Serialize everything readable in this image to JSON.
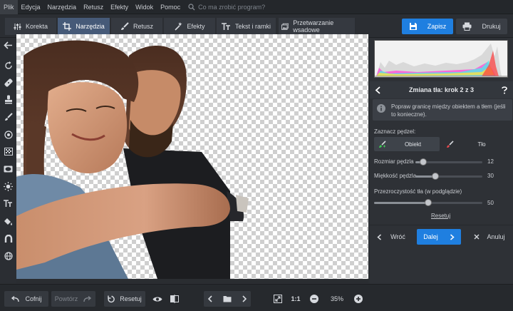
{
  "menu": [
    "Plik",
    "Edycja",
    "Narzędzia",
    "Retusz",
    "Efekty",
    "Widok",
    "Pomoc"
  ],
  "search": {
    "placeholder": "Co ma zrobić program?"
  },
  "tabs": [
    {
      "label": "Korekta",
      "icon": "sliders-icon"
    },
    {
      "label": "Narzędzia",
      "icon": "crop-icon",
      "active": true
    },
    {
      "label": "Retusz",
      "icon": "brush-icon"
    },
    {
      "label": "Efekty",
      "icon": "magic-wand-icon"
    },
    {
      "label": "Tekst i ramki",
      "icon": "text-icon"
    },
    {
      "label": "Przetwarzanie wsadowe",
      "icon": "images-icon"
    }
  ],
  "actions": {
    "save": "Zapisz",
    "print": "Drukuj"
  },
  "panel": {
    "title": "Zmiana tła: krok 2 z 3",
    "info": "Popraw granicę między obiektem a tłem (jeśli to konieczne).",
    "brush_label": "Zaznacz pędzel:",
    "object_label": "Obiekt",
    "background_label": "Tło",
    "sliders": [
      {
        "label": "Rozmiar pędzla",
        "value": "12",
        "fraction": 0.12
      },
      {
        "label": "Miękkość pędzla",
        "value": "30",
        "fraction": 0.3
      },
      {
        "label": "Przezroczystość tła (w podglądzie)",
        "value": "50",
        "fraction": 0.5
      }
    ],
    "reset": "Resetuj",
    "back": "Wróć",
    "next": "Dalej",
    "cancel": "Anuluj"
  },
  "bottom": {
    "undo": "Cofnij",
    "redo": "Powtórz",
    "reset": "Resetuj",
    "ratio": "1:1",
    "zoom": "35%"
  },
  "colors": {
    "accent": "#1f7fe0",
    "active_tab": "#465a78"
  }
}
